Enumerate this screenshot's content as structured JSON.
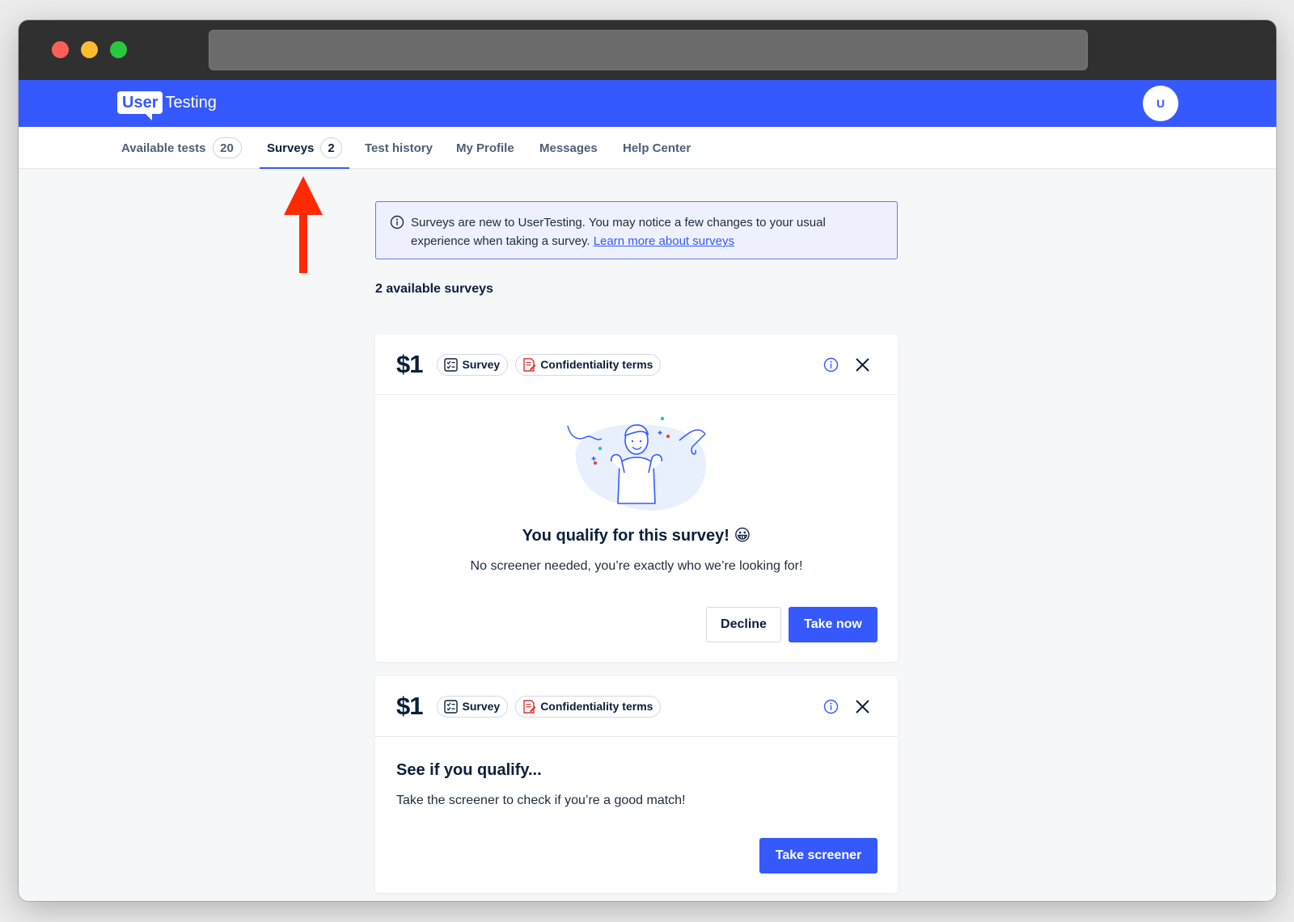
{
  "header": {
    "logo_user": "User",
    "logo_testing": "Testing",
    "avatar_initial": "U",
    "brand_color": "#3559ff"
  },
  "nav": {
    "tabs": [
      {
        "label": "Available tests",
        "count": "20"
      },
      {
        "label": "Surveys",
        "count": "2",
        "active": true
      },
      {
        "label": "Test history"
      },
      {
        "label": "My Profile"
      },
      {
        "label": "Messages"
      },
      {
        "label": "Help Center"
      }
    ]
  },
  "annotation": {
    "arrow_color": "#ff2a00"
  },
  "notice": {
    "text": "Surveys are new to UserTesting. You may notice a few changes to your usual experience when taking a survey. ",
    "link": "Learn more about surveys"
  },
  "surveys_count_title": "2 available surveys",
  "cards": [
    {
      "price": "$1",
      "tags": [
        "Survey",
        "Confidentiality terms"
      ],
      "title": "You qualify for this survey! 😀",
      "subtitle": "No screener needed, you’re exactly who we’re looking for!",
      "buttons": {
        "decline": "Decline",
        "take_now": "Take now"
      }
    },
    {
      "price": "$1",
      "tags": [
        "Survey",
        "Confidentiality terms"
      ],
      "title": "See if you qualify...",
      "subtitle": "Take the screener to check if you’re a good match!",
      "buttons": {
        "take_screener": "Take screener"
      }
    }
  ]
}
